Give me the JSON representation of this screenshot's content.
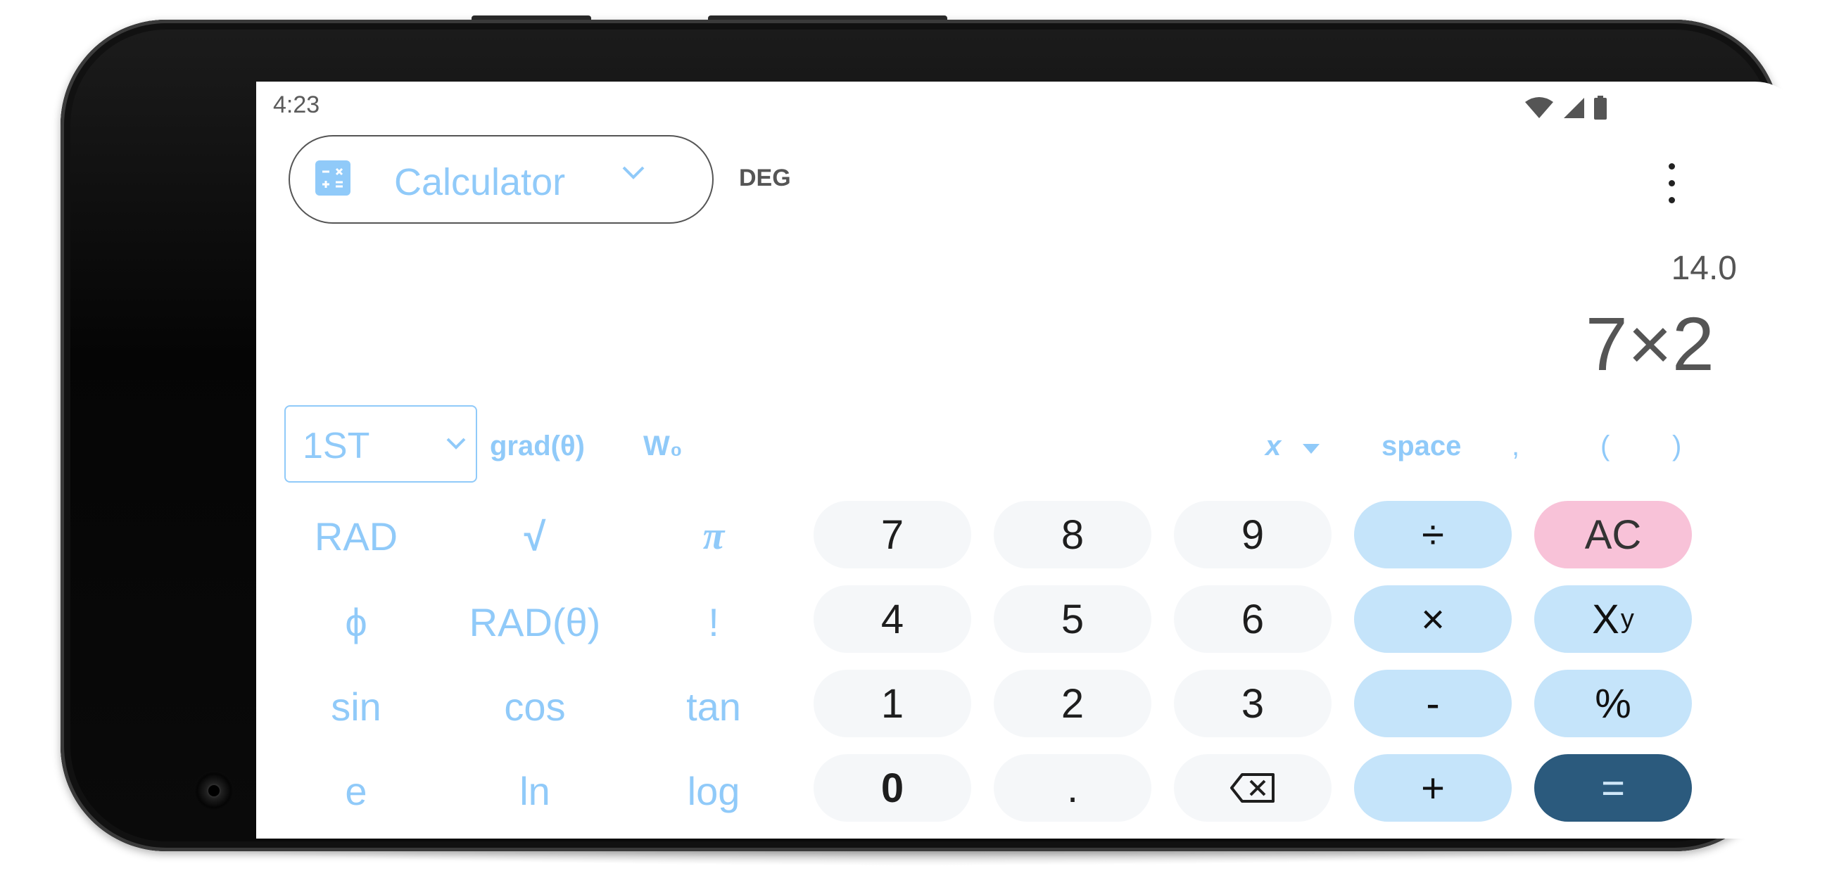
{
  "status_bar": {
    "time": "4:23"
  },
  "header": {
    "mode": "Calculator",
    "angle_mode": "DEG"
  },
  "display": {
    "result": "14.0",
    "expression": "7×2"
  },
  "aux_row": {
    "page": "1ST",
    "grad": "grad(θ)",
    "w0": "W₀",
    "x_menu": "x",
    "space": "space",
    "comma": ",",
    "open_paren": "(",
    "close_paren": ")"
  },
  "sci_keys": [
    "RAD",
    "√",
    "π",
    "ϕ",
    "RAD(θ)",
    "!",
    "sin",
    "cos",
    "tan",
    "e",
    "ln",
    "log"
  ],
  "pad": {
    "seven": "7",
    "eight": "8",
    "nine": "9",
    "divide": "÷",
    "ac": "AC",
    "four": "4",
    "five": "5",
    "six": "6",
    "multiply": "×",
    "power_base": "X",
    "power_exp": "y",
    "one": "1",
    "two": "2",
    "three": "3",
    "minus": "-",
    "percent": "%",
    "zero": "0",
    "dot": ".",
    "plus": "+",
    "equals": "="
  },
  "colors": {
    "accent_light": "#90caf9",
    "operator_bg": "#c5e4fa",
    "clear_bg": "#f8c2d8",
    "equals_bg": "#2b5a7d",
    "digit_bg": "#f5f7f9"
  },
  "icons": [
    "calculator-icon",
    "chevron-down-icon",
    "more-vert-icon",
    "wifi-icon",
    "cellular-icon",
    "battery-icon",
    "backspace-icon",
    "nav-recents-icon",
    "nav-home-icon",
    "nav-back-icon",
    "front-camera"
  ]
}
